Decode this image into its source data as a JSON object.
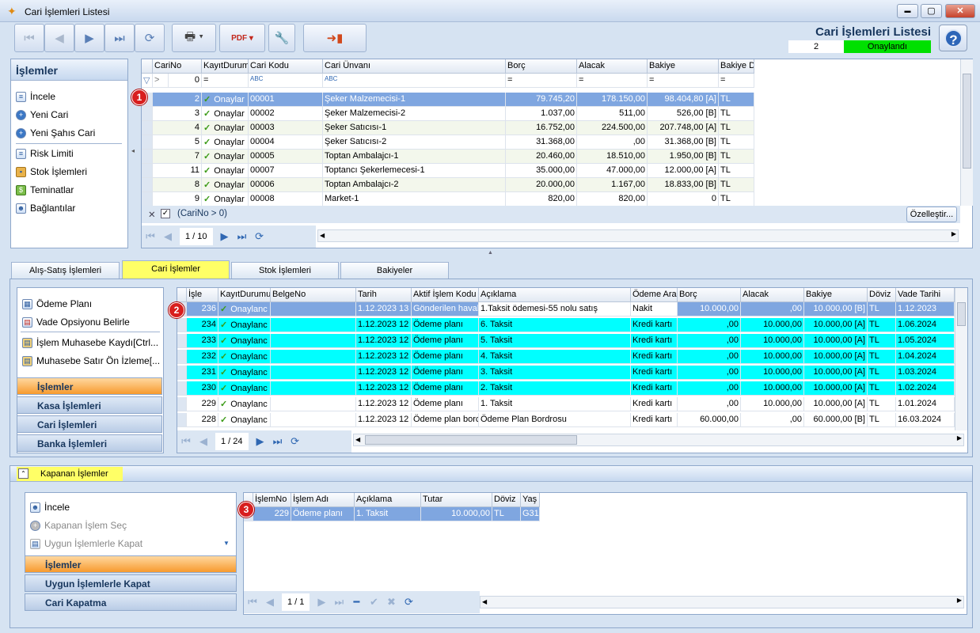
{
  "window": {
    "title": "Cari İşlemleri Listesi",
    "minimize": "▬",
    "restore": "▢",
    "close": "✕"
  },
  "header": {
    "title": "Cari İşlemleri Listesi",
    "status_number": "2",
    "status_label": "Onaylandı"
  },
  "colors": {
    "status_green": "#00e000",
    "cyan_row": "#00ffff",
    "selected_row": "#7fa6e0",
    "orange_active": "#f79a2e"
  },
  "sidebar": {
    "title": "İşlemler",
    "items": [
      {
        "label": "İncele",
        "icon": "document-icon"
      },
      {
        "label": "Yeni Cari",
        "icon": "plus-circle-icon"
      },
      {
        "label": "Yeni Şahıs Cari",
        "icon": "plus-circle-icon"
      },
      {
        "label": "Risk Limiti",
        "icon": "document-icon"
      },
      {
        "label": "Stok İşlemleri",
        "icon": "box-icon"
      },
      {
        "label": "Teminatlar",
        "icon": "money-icon"
      },
      {
        "label": "Bağlantılar",
        "icon": "people-icon"
      }
    ]
  },
  "top_grid": {
    "columns": [
      "CariNo",
      "KayıtDurumu",
      "Cari Kodu",
      "Cari Ünvanı",
      "Borç",
      "Alacak",
      "Bakiye",
      "Bakiye D"
    ],
    "filter_row": [
      "0",
      "=",
      "",
      "",
      "=",
      "=",
      "=",
      "="
    ],
    "rows": [
      [
        "2",
        "Onaylar",
        "00001",
        "Şeker Malzemecisi-1",
        "79.745,20",
        "178.150,00",
        "98.404,80 [A]",
        "TL"
      ],
      [
        "3",
        "Onaylar",
        "00002",
        "Şeker Malzemecisi-2",
        "1.037,00",
        "511,00",
        "526,00 [B]",
        "TL"
      ],
      [
        "4",
        "Onaylar",
        "00003",
        "Şeker Satıcısı-1",
        "16.752,00",
        "224.500,00",
        "207.748,00 [A]",
        "TL"
      ],
      [
        "5",
        "Onaylar",
        "00004",
        "Şeker Satıcısı-2",
        "31.368,00",
        ",00",
        "31.368,00 [B]",
        "TL"
      ],
      [
        "7",
        "Onaylar",
        "00005",
        "Toptan Ambalajcı-1",
        "20.460,00",
        "18.510,00",
        "1.950,00 [B]",
        "TL"
      ],
      [
        "11",
        "Onaylar",
        "00007",
        "Toptancı Şekerlemecesi-1",
        "35.000,00",
        "47.000,00",
        "12.000,00 [A]",
        "TL"
      ],
      [
        "8",
        "Onaylar",
        "00006",
        "Toptan Ambalajcı-2",
        "20.000,00",
        "1.167,00",
        "18.833,00 [B]",
        "TL"
      ],
      [
        "9",
        "Onaylar",
        "00008",
        "Market-1",
        "820,00",
        "820,00",
        "0",
        "TL"
      ]
    ],
    "filter_text": "(CariNo > 0)",
    "customize_label": "Özelleştir...",
    "page": "1 / 10"
  },
  "tabs": [
    "Alış-Satış İşlemleri",
    "Cari İşlemler",
    "Stok İşlemleri",
    "Bakiyeler"
  ],
  "mid_side": {
    "items": [
      {
        "label": "Ödeme Planı",
        "icon": "table-icon"
      },
      {
        "label": "Vade Opsiyonu Belirle",
        "icon": "calendar-icon"
      },
      {
        "label": "İşlem Muhasebe Kaydı[Ctrl...",
        "icon": "ledger-icon"
      },
      {
        "label": "Muhasebe Satır Ön İzleme[...",
        "icon": "ledger-icon"
      }
    ],
    "groups": [
      "İşlemler",
      "Kasa İşlemleri",
      "Cari İşlemleri",
      "Banka İşlemleri"
    ]
  },
  "mid_grid": {
    "columns": [
      "İşle",
      "KayıtDurumu",
      "BelgeNo",
      "Tarih",
      "Aktif İşlem Kodu",
      "Açıklama",
      "Ödeme Ara",
      "Borç",
      "Alacak",
      "Bakiye",
      "Döviz",
      "Vade Tarihi"
    ],
    "rows": [
      [
        "236",
        "Onaylanc",
        "",
        "1.12.2023 13",
        "Gönderilen haval",
        "1.Taksit ödemesi-55 nolu satış",
        "Nakit",
        "10.000,00",
        ",00",
        "10.000,00 [B]",
        "TL",
        "1.12.2023"
      ],
      [
        "234",
        "Onaylanc",
        "",
        "1.12.2023 12",
        "Ödeme planı",
        "6. Taksit",
        "Kredi kartı",
        ",00",
        "10.000,00",
        "10.000,00 [A]",
        "TL",
        "1.06.2024"
      ],
      [
        "233",
        "Onaylanc",
        "",
        "1.12.2023 12",
        "Ödeme planı",
        "5. Taksit",
        "Kredi kartı",
        ",00",
        "10.000,00",
        "10.000,00 [A]",
        "TL",
        "1.05.2024"
      ],
      [
        "232",
        "Onaylanc",
        "",
        "1.12.2023 12",
        "Ödeme planı",
        "4. Taksit",
        "Kredi kartı",
        ",00",
        "10.000,00",
        "10.000,00 [A]",
        "TL",
        "1.04.2024"
      ],
      [
        "231",
        "Onaylanc",
        "",
        "1.12.2023 12",
        "Ödeme planı",
        "3. Taksit",
        "Kredi kartı",
        ",00",
        "10.000,00",
        "10.000,00 [A]",
        "TL",
        "1.03.2024"
      ],
      [
        "230",
        "Onaylanc",
        "",
        "1.12.2023 12",
        "Ödeme planı",
        "2. Taksit",
        "Kredi kartı",
        ",00",
        "10.000,00",
        "10.000,00 [A]",
        "TL",
        "1.02.2024"
      ],
      [
        "229",
        "Onaylanc",
        "",
        "1.12.2023 12",
        "Ödeme planı",
        "1. Taksit",
        "Kredi kartı",
        ",00",
        "10.000,00",
        "10.000,00 [A]",
        "TL",
        "1.01.2024"
      ],
      [
        "228",
        "Onaylanc",
        "",
        "1.12.2023 12",
        "Ödeme plan borc",
        "Ödeme Plan Bordrosu",
        "Kredi kartı",
        "60.000,00",
        ",00",
        "60.000,00 [B]",
        "TL",
        "16.03.2024"
      ]
    ],
    "page": "1 / 24"
  },
  "bottom": {
    "group_title": "Kapanan İşlemler",
    "side_items": [
      {
        "label": "İncele",
        "icon": "people-icon"
      },
      {
        "label": "Kapanan İşlem Seç",
        "icon": "plus-circle-icon"
      },
      {
        "label": "Uygun İşlemlerle Kapat",
        "icon": "clipboard-icon"
      }
    ],
    "groups": [
      "İşlemler",
      "Uygun İşlemlerle Kapat",
      "Cari Kapatma"
    ],
    "columns": [
      "İşlemNo",
      "İşlem Adı",
      "Açıklama",
      "Tutar",
      "Döviz",
      "Yaş"
    ],
    "rows": [
      [
        "229",
        "Ödeme planı",
        "1. Taksit",
        "10.000,00",
        "TL",
        "G31"
      ]
    ],
    "page": "1 / 1"
  },
  "markers": [
    "1",
    "2",
    "3"
  ]
}
